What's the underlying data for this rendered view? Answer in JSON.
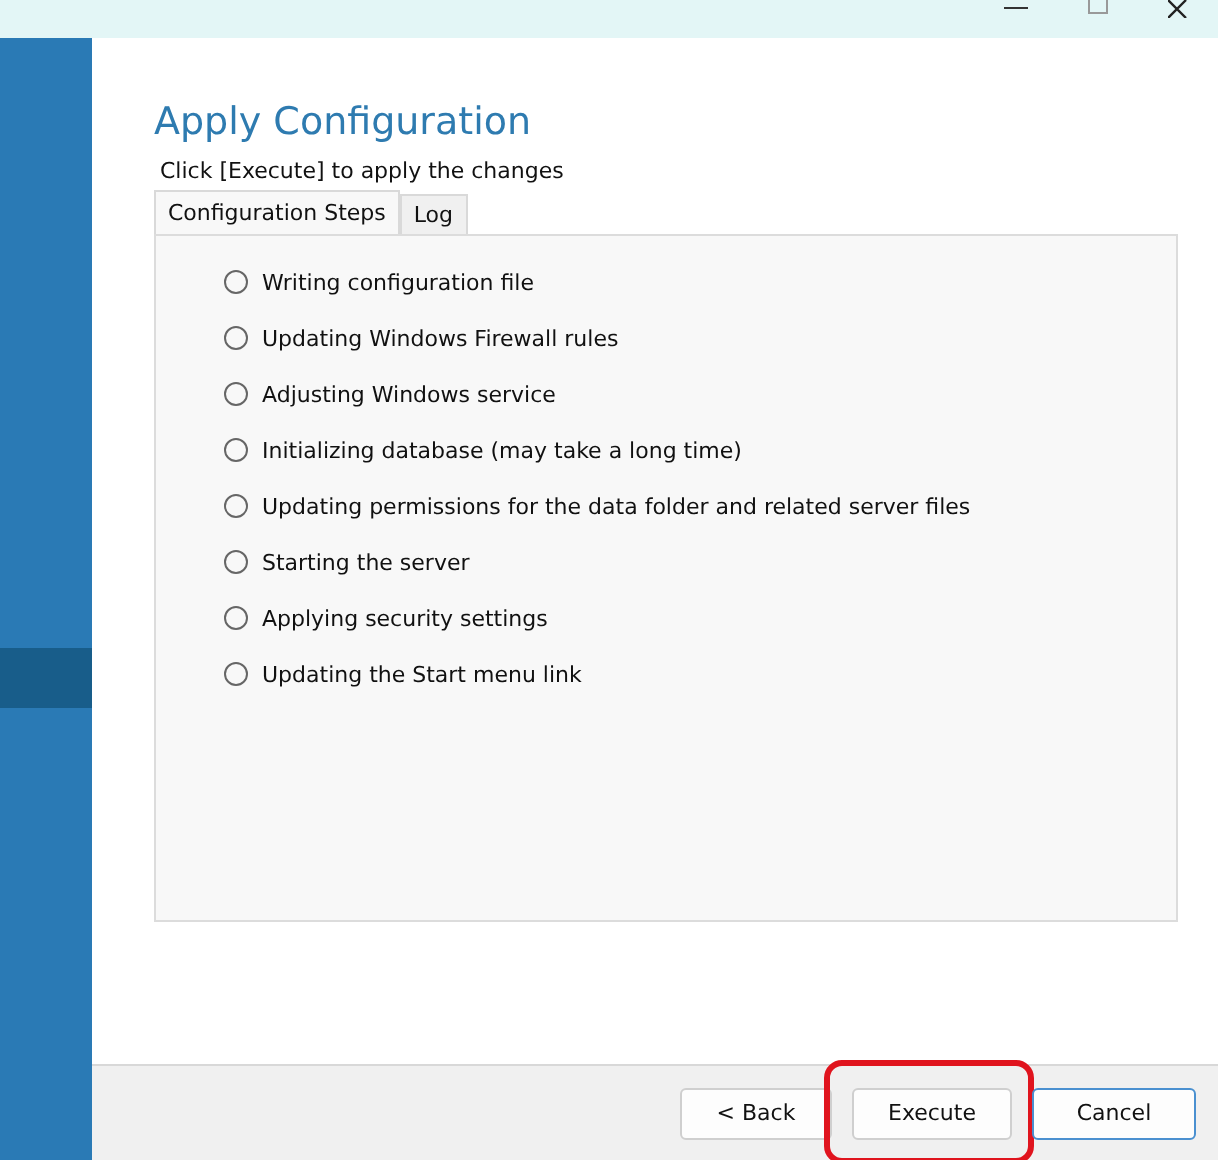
{
  "sidebar": {
    "items": [
      {
        "selected": false
      },
      {
        "selected": false
      },
      {
        "selected": false
      },
      {
        "selected": false
      },
      {
        "selected": false
      },
      {
        "selected": false
      },
      {
        "selected": false
      },
      {
        "selected": false
      },
      {
        "selected": false
      },
      {
        "selected": true
      },
      {
        "selected": false
      }
    ]
  },
  "page": {
    "title": "Apply Configuration",
    "subtitle": "Click [Execute] to apply the changes"
  },
  "tabs": [
    {
      "label": "Configuration Steps",
      "selected": true
    },
    {
      "label": "Log",
      "selected": false
    }
  ],
  "steps": [
    {
      "label": "Writing configuration file",
      "done": false
    },
    {
      "label": "Updating Windows Firewall rules",
      "done": false
    },
    {
      "label": "Adjusting Windows service",
      "done": false
    },
    {
      "label": "Initializing database (may take a long time)",
      "done": false
    },
    {
      "label": "Updating permissions for the data folder and related server files",
      "done": false
    },
    {
      "label": "Starting the server",
      "done": false
    },
    {
      "label": "Applying security settings",
      "done": false
    },
    {
      "label": "Updating the Start menu link",
      "done": false
    }
  ],
  "buttons": [
    {
      "label": "< Back",
      "highlighted": false,
      "default": false
    },
    {
      "label": "Execute",
      "highlighted": true,
      "default": false
    },
    {
      "label": "Cancel",
      "highlighted": false,
      "default": true
    }
  ]
}
